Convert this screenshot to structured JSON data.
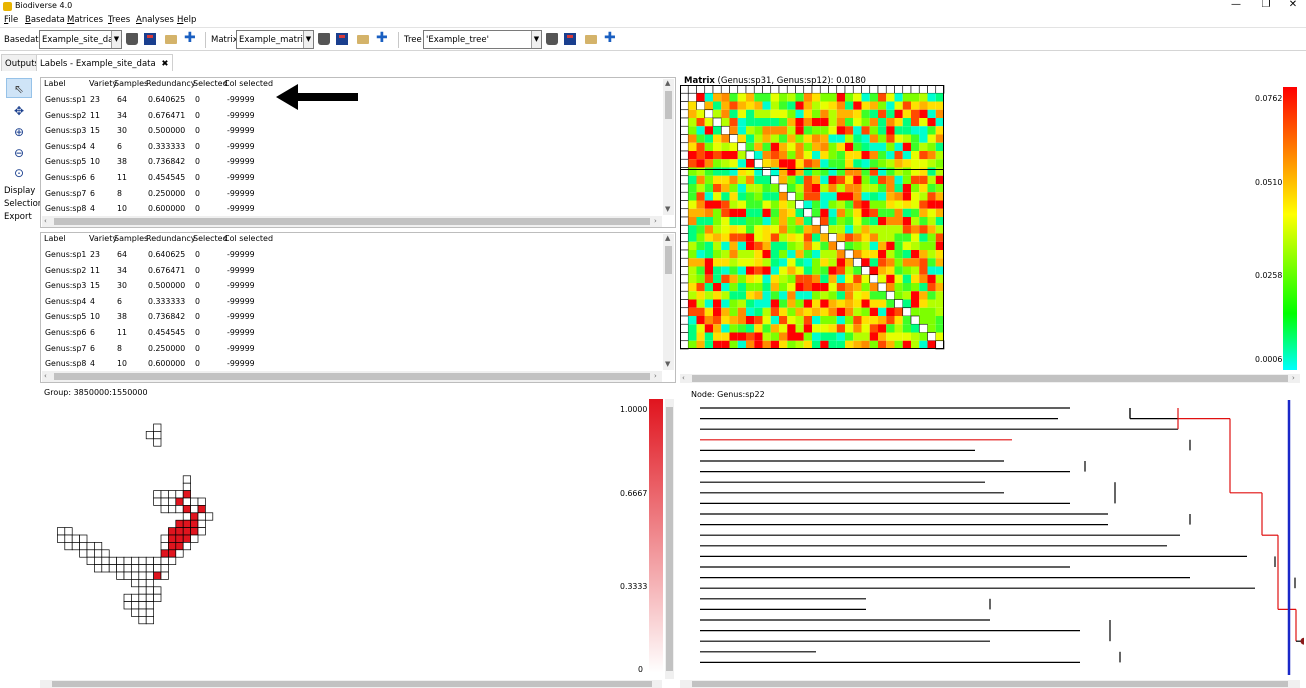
{
  "window": {
    "title": "Biodiverse 4.0",
    "min": "—",
    "max": "❐",
    "close": "✕"
  },
  "menu": [
    {
      "pre": "",
      "u": "F",
      "post": "ile"
    },
    {
      "pre": "",
      "u": "B",
      "post": "asedata"
    },
    {
      "pre": "",
      "u": "M",
      "post": "atrices"
    },
    {
      "pre": "",
      "u": "T",
      "post": "rees"
    },
    {
      "pre": "",
      "u": "A",
      "post": "nalyses"
    },
    {
      "pre": "",
      "u": "H",
      "post": "elp"
    }
  ],
  "toolbar": {
    "basedata_label": "Basedata",
    "basedata_value": "Example_site_data",
    "matrix_label": "Matrix",
    "matrix_value": "Example_matrix",
    "tree_label": "Tree",
    "tree_value": "'Example_tree'"
  },
  "tabs": {
    "outputs": "Outputs",
    "labels": "Labels - Example_site_data",
    "close": "✖"
  },
  "tools": {
    "display": "Display",
    "selection": "Selection",
    "export": "Export"
  },
  "table": {
    "headers": [
      "Label",
      "Variety",
      "Samples",
      "Redundancy",
      "Selected",
      "Col selected"
    ],
    "rows": [
      [
        "Genus:sp1",
        "23",
        "64",
        "0.640625",
        "0",
        "-99999"
      ],
      [
        "Genus:sp2",
        "11",
        "34",
        "0.676471",
        "0",
        "-99999"
      ],
      [
        "Genus:sp3",
        "15",
        "30",
        "0.500000",
        "0",
        "-99999"
      ],
      [
        "Genus:sp4",
        "4",
        "6",
        "0.333333",
        "0",
        "-99999"
      ],
      [
        "Genus:sp5",
        "10",
        "38",
        "0.736842",
        "0",
        "-99999"
      ],
      [
        "Genus:sp6",
        "6",
        "11",
        "0.454545",
        "0",
        "-99999"
      ],
      [
        "Genus:sp7",
        "6",
        "8",
        "0.250000",
        "0",
        "-99999"
      ],
      [
        "Genus:sp8",
        "4",
        "10",
        "0.600000",
        "0",
        "-99999"
      ]
    ]
  },
  "matrix": {
    "title_bold": "Matrix",
    "title_rest": " (Genus:sp31, Genus:sp12): 0.0180",
    "legend": [
      "0.0762",
      "0.0510",
      "0.0258",
      "0.0006"
    ],
    "colors": {
      "high": "#ff0000",
      "mid": "#ffff00",
      "low": "#00ff00",
      "min": "#00ffff"
    }
  },
  "group": {
    "label": "Group: 3850000:1550000",
    "legend": [
      "1.0000",
      "0.6667",
      "0.3333",
      "0"
    ],
    "colors": {
      "selected": "#e0141e",
      "empty": "#ffffff"
    }
  },
  "tree": {
    "label": "Node: Genus:sp22",
    "colors": {
      "highlight": "#e01010",
      "marker": "#1a28c8",
      "node": "#8b1a1a"
    }
  }
}
